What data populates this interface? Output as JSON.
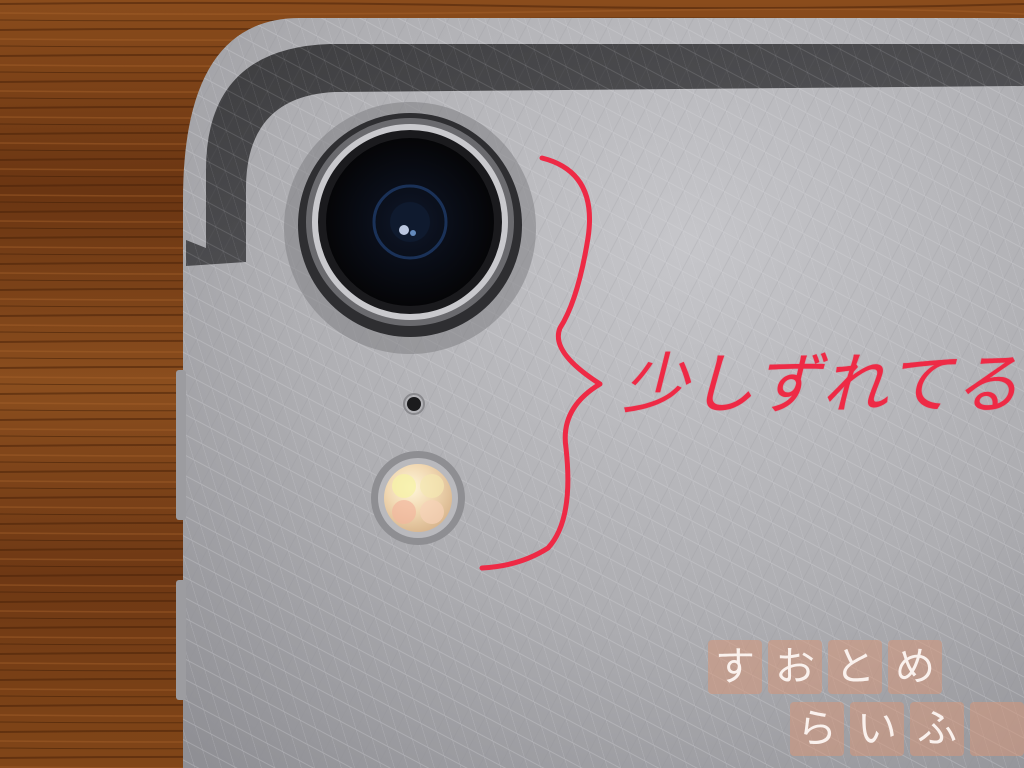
{
  "annotation": {
    "text": "少しずれてる",
    "color": "#ee2a45"
  },
  "watermark": {
    "row1": [
      "す",
      "お",
      "と",
      "め"
    ],
    "row2": [
      "ら",
      "い",
      "ふ"
    ]
  },
  "colors": {
    "wood": "#7a4218",
    "device_body": "#a9a9ad",
    "lens": "#0d0d10"
  }
}
